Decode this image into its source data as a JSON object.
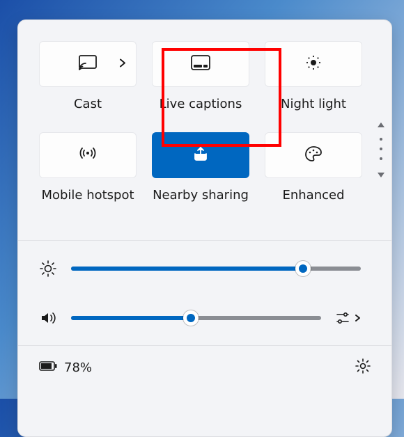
{
  "tiles": [
    {
      "label": "Cast"
    },
    {
      "label": "Live captions"
    },
    {
      "label": "Night light"
    },
    {
      "label": "Mobile hotspot"
    },
    {
      "label": "Nearby sharing"
    },
    {
      "label": "Enhanced"
    }
  ],
  "sliders": {
    "brightness": {
      "percent": 80
    },
    "volume": {
      "percent": 48
    }
  },
  "footer": {
    "battery_text": "78%"
  }
}
